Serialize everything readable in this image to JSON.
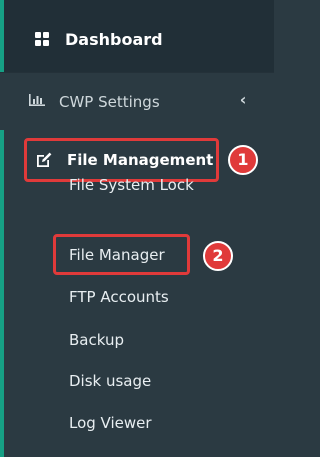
{
  "sidebar": {
    "dashboard": {
      "label": "Dashboard",
      "icon": "dashboard-grid-icon"
    },
    "cwp_settings": {
      "label": "CWP Settings",
      "icon": "bar-chart-icon",
      "chevron": "‹"
    },
    "file_management": {
      "label": "File Management",
      "icon": "edit-icon"
    },
    "sub_items": [
      {
        "label": "File System Lock"
      },
      {
        "label": "File Manager"
      },
      {
        "label": "FTP Accounts"
      },
      {
        "label": "Backup"
      },
      {
        "label": "Disk usage"
      },
      {
        "label": "Log Viewer"
      }
    ]
  },
  "annotations": {
    "badge_1": "1",
    "badge_2": "2",
    "highlight_color": "#e03a3a"
  },
  "colors": {
    "accent": "#16a085",
    "sidebar_bg": "#2b3a42",
    "active_bg": "#212f37"
  }
}
